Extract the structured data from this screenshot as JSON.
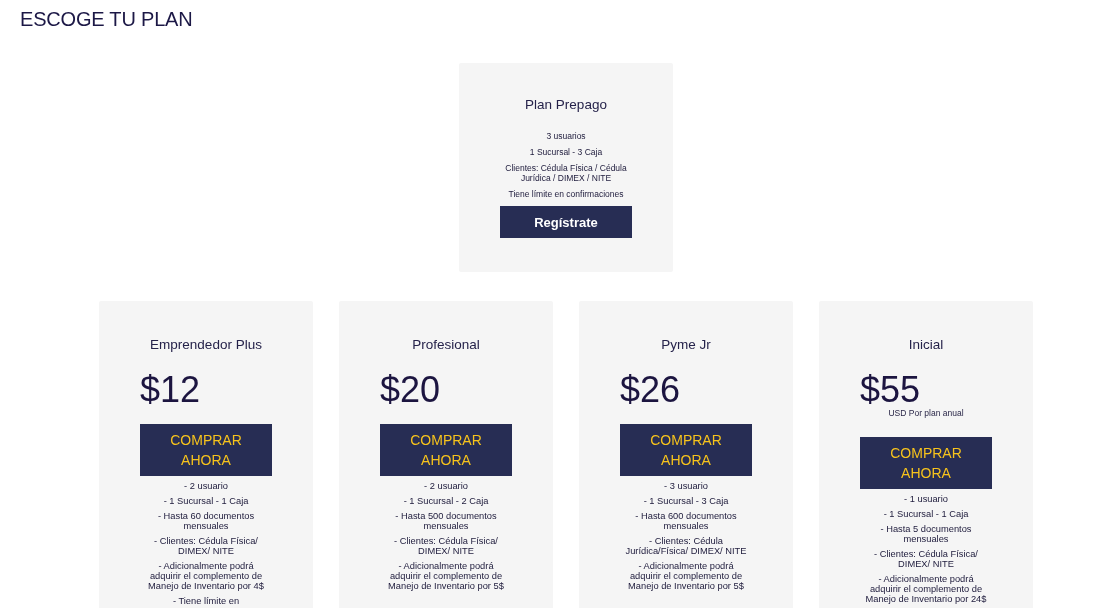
{
  "page": {
    "title": "ESCOGE TU PLAN"
  },
  "featured_plan": {
    "name": "Plan Prepago",
    "features": [
      "3 usuarios",
      "1 Sucursal - 3 Caja",
      "Clientes: Cédula Física / Cédula Jurídica / DIMEX / NITE",
      "Tiene límite en confirmaciones"
    ],
    "button": "Regístrate"
  },
  "plans": [
    {
      "name": "Emprendedor Plus",
      "price": "$12",
      "button": "COMPRAR AHORA",
      "features": [
        "- 2 usuario",
        "- 1 Sucursal - 1 Caja",
        "- Hasta 60 documentos mensuales",
        "- Clientes: Cédula Física/ DIMEX/ NITE",
        "- Adicionalmente podrá adquirir el complemento de Manejo de Inventario por 4$",
        "- Tiene límite en"
      ]
    },
    {
      "name": "Profesional",
      "price": "$20",
      "button": "COMPRAR AHORA",
      "features": [
        "- 2 usuario",
        "- 1 Sucursal - 2 Caja",
        "- Hasta 500 documentos mensuales",
        "- Clientes: Cédula Física/ DIMEX/ NITE",
        "- Adicionalmente podrá adquirir el complemento de Manejo de Inventario por 5$"
      ]
    },
    {
      "name": "Pyme Jr",
      "price": "$26",
      "button": "COMPRAR AHORA",
      "features": [
        "- 3 usuario",
        "- 1 Sucursal - 3 Caja",
        "- Hasta 600 documentos mensuales",
        "- Clientes: Cédula Jurídica/Física/ DIMEX/ NITE",
        "- Adicionalmente podrá adquirir el complemento de Manejo de Inventario por 5$"
      ]
    },
    {
      "name": "Inicial",
      "price": "$55",
      "price_note": "USD Por plan anual",
      "button": "COMPRAR AHORA",
      "features": [
        "- 1 usuario",
        "- 1 Sucursal - 1 Caja",
        "- Hasta 5 documentos mensuales",
        "- Clientes: Cédula Física/ DIMEX/ NITE",
        "- Adicionalmente podrá adquirir el complemento de Manejo de Inventario por 24$"
      ]
    }
  ]
}
